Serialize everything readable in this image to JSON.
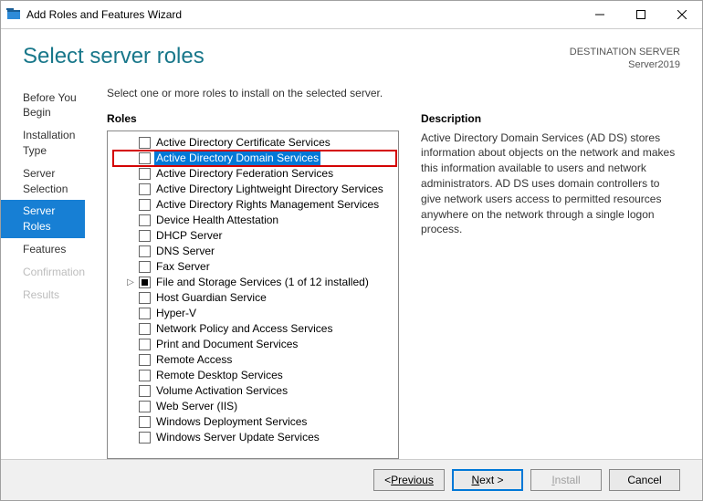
{
  "window": {
    "title": "Add Roles and Features Wizard"
  },
  "header": {
    "page_title": "Select server roles",
    "destination_label": "DESTINATION SERVER",
    "destination_value": "Server2019"
  },
  "nav": {
    "items": [
      {
        "label": "Before You Begin",
        "state": "normal"
      },
      {
        "label": "Installation Type",
        "state": "normal"
      },
      {
        "label": "Server Selection",
        "state": "normal"
      },
      {
        "label": "Server Roles",
        "state": "active"
      },
      {
        "label": "Features",
        "state": "normal"
      },
      {
        "label": "Confirmation",
        "state": "disabled"
      },
      {
        "label": "Results",
        "state": "disabled"
      }
    ]
  },
  "main": {
    "instruction": "Select one or more roles to install on the selected server.",
    "roles_label": "Roles",
    "description_label": "Description",
    "description_text": "Active Directory Domain Services (AD DS) stores information about objects on the network and makes this information available to users and network administrators. AD DS uses domain controllers to give network users access to permitted resources anywhere on the network through a single logon process.",
    "roles": [
      {
        "label": "Active Directory Certificate Services"
      },
      {
        "label": "Active Directory Domain Services",
        "highlight": true,
        "redbox": true
      },
      {
        "label": "Active Directory Federation Services"
      },
      {
        "label": "Active Directory Lightweight Directory Services"
      },
      {
        "label": "Active Directory Rights Management Services"
      },
      {
        "label": "Device Health Attestation"
      },
      {
        "label": "DHCP Server"
      },
      {
        "label": "DNS Server"
      },
      {
        "label": "Fax Server"
      },
      {
        "label": "File and Storage Services (1 of 12 installed)",
        "expander": "▷",
        "partial": true
      },
      {
        "label": "Host Guardian Service"
      },
      {
        "label": "Hyper-V"
      },
      {
        "label": "Network Policy and Access Services"
      },
      {
        "label": "Print and Document Services"
      },
      {
        "label": "Remote Access"
      },
      {
        "label": "Remote Desktop Services"
      },
      {
        "label": "Volume Activation Services"
      },
      {
        "label": "Web Server (IIS)"
      },
      {
        "label": "Windows Deployment Services"
      },
      {
        "label": "Windows Server Update Services"
      }
    ]
  },
  "footer": {
    "previous": "Previous",
    "next": "Next >",
    "install": "Install",
    "cancel": "Cancel"
  }
}
